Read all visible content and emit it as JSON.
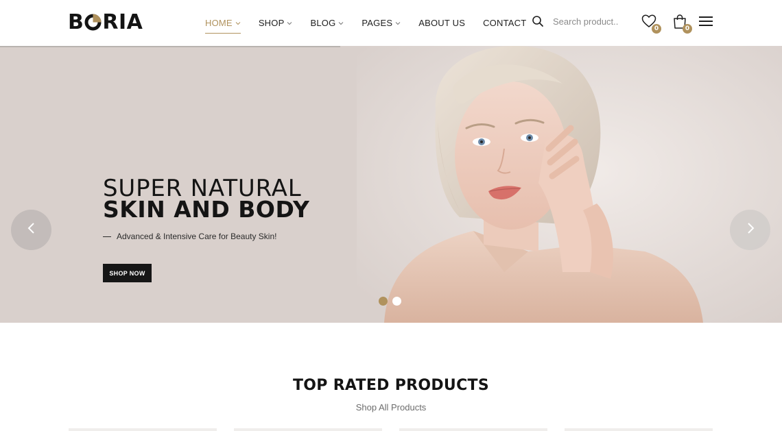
{
  "header": {
    "logo": {
      "prefix": "B",
      "suffix": "RIA"
    },
    "nav": [
      {
        "label": "HOME",
        "active": true,
        "has_dropdown": true
      },
      {
        "label": "SHOP",
        "active": false,
        "has_dropdown": true
      },
      {
        "label": "BLOG",
        "active": false,
        "has_dropdown": true
      },
      {
        "label": "PAGES",
        "active": false,
        "has_dropdown": true
      },
      {
        "label": "ABOUT US",
        "active": false,
        "has_dropdown": false
      },
      {
        "label": "CONTACT",
        "active": false,
        "has_dropdown": false
      }
    ],
    "search": {
      "placeholder": "Search product..",
      "icon": "search-icon"
    },
    "wishlist": {
      "count": "0",
      "icon": "heart-icon"
    },
    "cart": {
      "count": "0",
      "icon": "shopping-bag-icon"
    },
    "menu_icon": "hamburger-menu-icon"
  },
  "hero": {
    "title_line1": "SUPER NATURAL",
    "title_line2": "SKIN AND BODY",
    "subtitle": "Advanced & Intensive Care for Beauty Skin!",
    "button_label": "SHOP NOW",
    "prev_icon": "chevron-left-icon",
    "next_icon": "chevron-right-icon",
    "slides": {
      "total": 2,
      "active_index": 0
    }
  },
  "section": {
    "title": "TOP RATED PRODUCTS",
    "link": "Shop All Products"
  },
  "colors": {
    "accent": "#b0925d",
    "text_dark": "#141414",
    "hero_bg": "#d9d0cc",
    "button_bg": "#161616"
  }
}
